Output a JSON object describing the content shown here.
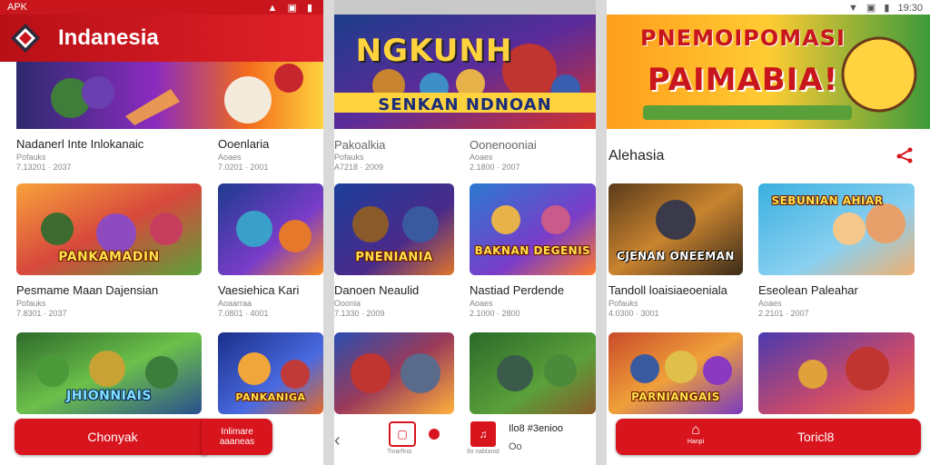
{
  "colors": {
    "brand_red": "#d8141d",
    "header_red": "#c8161c"
  },
  "screen1": {
    "status_left": "APK",
    "app_title": "Indanesia",
    "games_row1": [
      {
        "title": "Nadanerl Inte Inlokanaic",
        "meta1": "Pofauks",
        "meta2": "7.13201 · 2037"
      },
      {
        "title": "Ooenlaria",
        "meta1": "Aoaes",
        "meta2": "7.0201 · 2001"
      }
    ],
    "tiles_row2": [
      {
        "text": "PANKAMADIN"
      },
      {
        "text": ""
      }
    ],
    "games_row2": [
      {
        "title": "Pesmame Maan Dajensian",
        "meta1": "Pofauks",
        "meta2": "7.8301 · 2037"
      },
      {
        "title": "Vaesiehica Kari",
        "meta1": "Aoaarraa",
        "meta2": "7.0801 · 4001"
      }
    ],
    "tiles_row3": [
      {
        "text": "JHIONNIAIS"
      },
      {
        "text": "PANKANIGA"
      }
    ],
    "bottom_button": "Chonyak",
    "bottom_side_line1": "Inlimare",
    "bottom_side_line2": "aaaneas"
  },
  "screen2": {
    "banner_line1": "NGKUNH",
    "banner_line2": "SENKAN NDNOAN",
    "games_row1": [
      {
        "title": "Pakoalkia",
        "meta1": "Pofauks",
        "meta2": "A7218 · 2009"
      },
      {
        "title": "Oonenooniai",
        "meta1": "Aoaes",
        "meta2": "2.1800 · 2007"
      }
    ],
    "tiles_row2": [
      {
        "text": "PNENIANIA"
      },
      {
        "text": "BAKNAN DEGENIS"
      }
    ],
    "games_row2": [
      {
        "title": "Danoen Neaulid",
        "meta1": "Ooonla",
        "meta2": "7.1330 · 2009"
      },
      {
        "title": "Nastiad Perdende",
        "meta1": "Aoaes",
        "meta2": "2.1000 · 2800"
      }
    ],
    "bottom_label": "Tinarfina",
    "bottom_label2": "Ilo nablanid",
    "bottom_title": "Ilo8 #3enioo",
    "bottom_sub": "Oo"
  },
  "screen3": {
    "status_time": "19:30",
    "banner_line1": "PNEMOIPOMASI",
    "banner_line2": "PAIMABIA!",
    "section_title": "Alehasia",
    "tiles_row2": [
      {
        "text": "CJENAN ONEEMAN"
      },
      {
        "text": "SEBUNIAN AHIAR"
      }
    ],
    "games_row2": [
      {
        "title": "Tandoll loaisiaeoeniala",
        "meta1": "Pofauks",
        "meta2": "4.0300 · 3001"
      },
      {
        "title": "Eseolean Paleahar",
        "meta1": "Aoaes",
        "meta2": "2.2101 · 2007"
      }
    ],
    "tiles_row3": [
      {
        "text": "PARNIANGAIS"
      },
      {
        "text": ""
      }
    ],
    "bottom_icon_label": "Hanpi",
    "bottom_button": "Toricl8"
  }
}
